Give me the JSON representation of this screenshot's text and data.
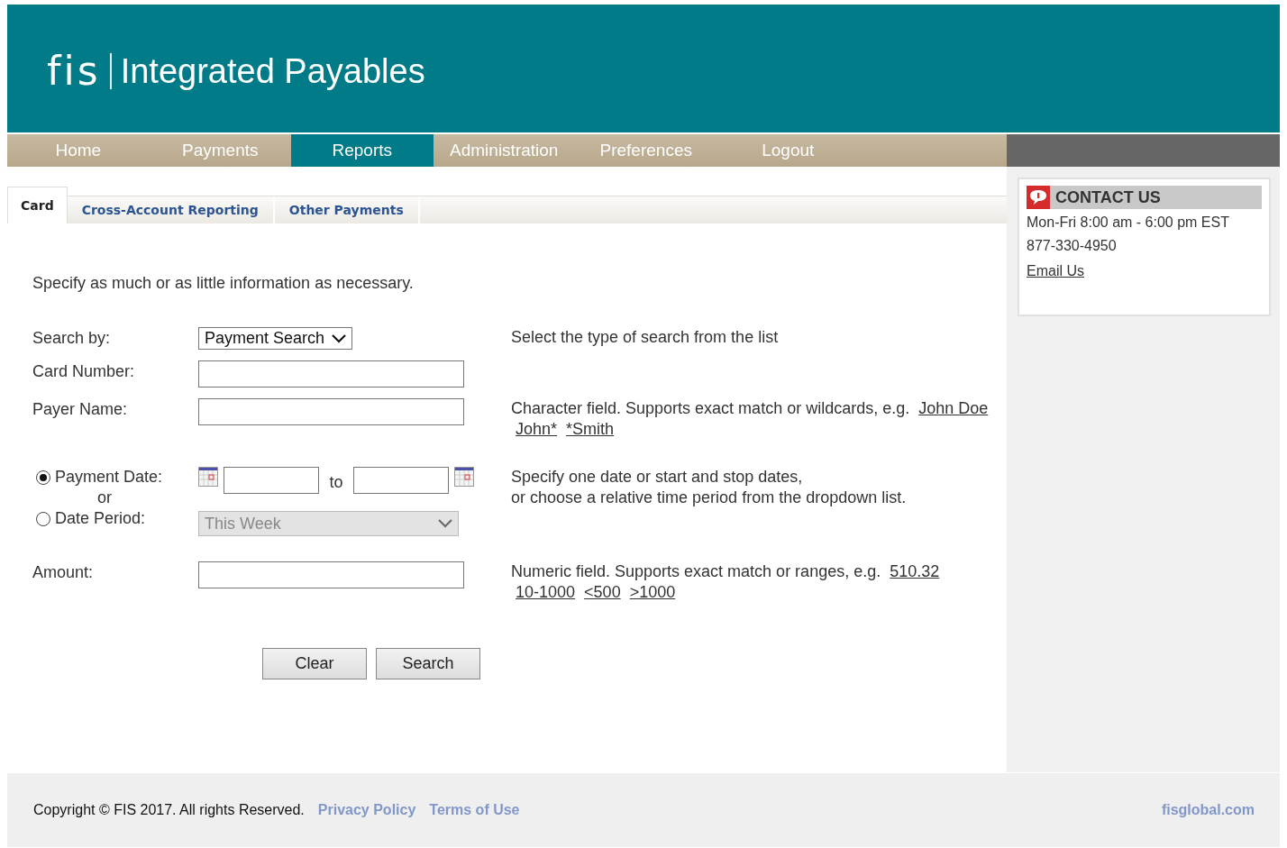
{
  "header": {
    "logo": "fis",
    "title": "Integrated Payables"
  },
  "nav": [
    {
      "label": "Home",
      "selected": false
    },
    {
      "label": "Payments",
      "selected": false
    },
    {
      "label": "Reports",
      "selected": true
    },
    {
      "label": "Administration",
      "selected": false
    },
    {
      "label": "Preferences",
      "selected": false
    },
    {
      "label": "Logout",
      "selected": false
    }
  ],
  "tabs": [
    {
      "label": "Card",
      "selected": true
    },
    {
      "label": "Cross-Account Reporting",
      "selected": false
    },
    {
      "label": "Other Payments",
      "selected": false
    }
  ],
  "intro": "Specify as much or as little information as necessary.",
  "form": {
    "search_by": {
      "label": "Search by:",
      "value": "Payment Search",
      "hint": "Select the type of search from the list"
    },
    "card_number": {
      "label": "Card Number:"
    },
    "payer_name": {
      "label": "Payer Name:",
      "hint": "Character field. Supports exact match or wildcards, e.g.",
      "examples": [
        "John Doe",
        "John*",
        "*Smith"
      ]
    },
    "date": {
      "options": [
        {
          "label": "Payment Date:",
          "selected": true
        },
        {
          "label": "Date Period:",
          "selected": false
        }
      ],
      "or": "or",
      "to": "to",
      "period": "This Week",
      "disabled": true,
      "hint_lines": [
        "Specify one date or start and stop dates,",
        "or choose a relative time period from the dropdown list."
      ]
    },
    "amount": {
      "label": "Amount:",
      "hint": "Numeric field. Supports exact match or ranges, e.g.",
      "examples": [
        "510.32",
        "10-1000",
        "<500",
        ">1000"
      ]
    },
    "buttons": [
      "Clear",
      "Search"
    ]
  },
  "contact": {
    "title": "CONTACT US",
    "hours": "Mon-Fri 8:00 am - 6:00 pm EST",
    "phone": "877-330-4950",
    "email": "Email Us"
  },
  "footer": {
    "copyright": "Copyright © FIS 2017. All rights Reserved.",
    "links": [
      "Privacy Policy",
      "Terms of Use"
    ],
    "site": "fisglobal.com"
  }
}
